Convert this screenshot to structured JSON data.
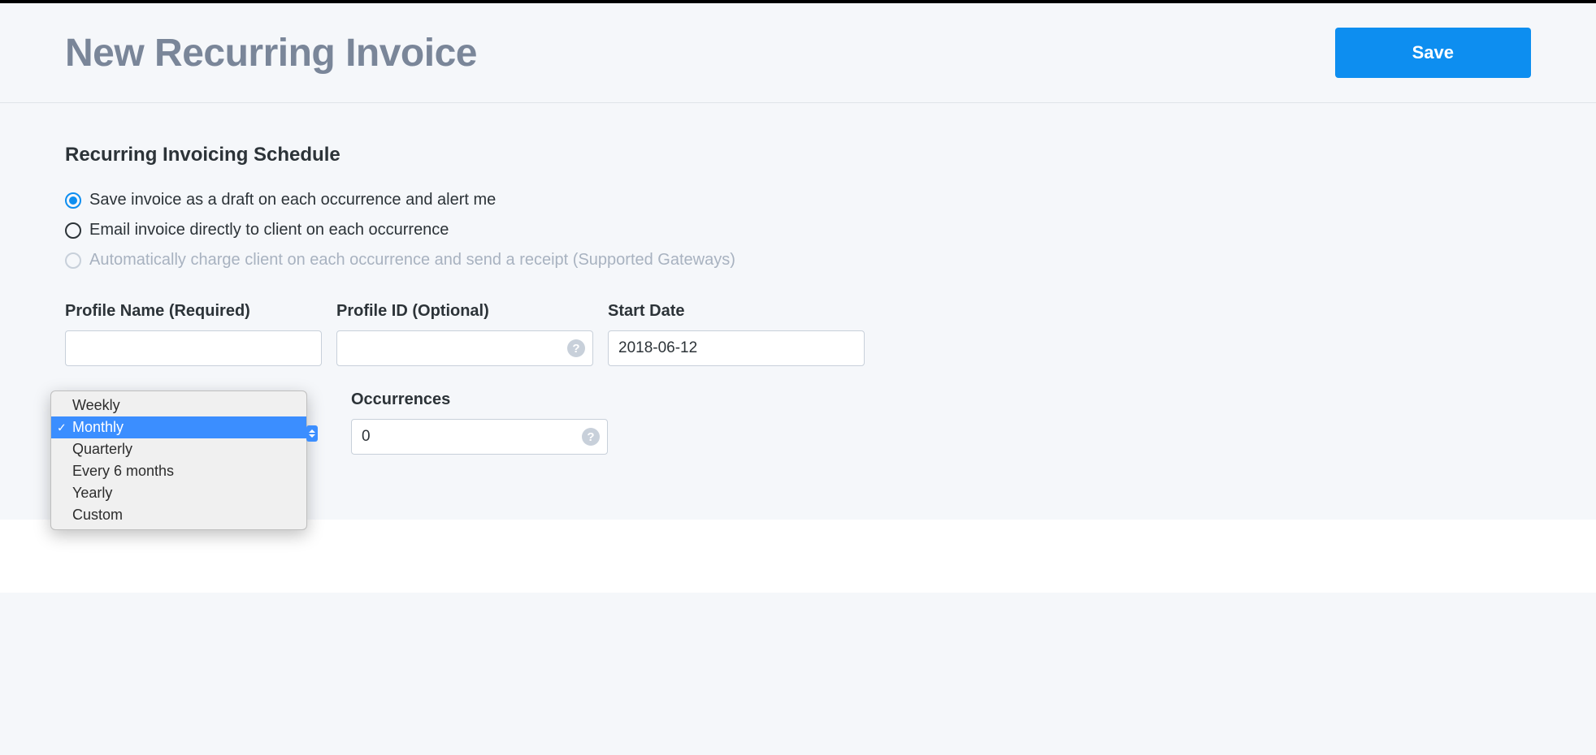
{
  "header": {
    "title": "New Recurring Invoice",
    "save_label": "Save"
  },
  "section": {
    "title": "Recurring Invoicing Schedule"
  },
  "radio_options": {
    "draft": "Save invoice as a draft on each occurrence and alert me",
    "email": "Email invoice directly to client on each occurrence",
    "auto_charge": "Automatically charge client on each occurrence and send a receipt (Supported Gateways)"
  },
  "fields": {
    "profile_name": {
      "label": "Profile Name (Required)",
      "value": ""
    },
    "profile_id": {
      "label": "Profile ID (Optional)",
      "value": ""
    },
    "start_date": {
      "label": "Start Date",
      "value": "2018-06-12"
    },
    "occurrences": {
      "label": "Occurrences",
      "value": "0"
    }
  },
  "frequency_dropdown": {
    "options": {
      "weekly": "Weekly",
      "monthly": "Monthly",
      "quarterly": "Quarterly",
      "every_6_months": "Every 6 months",
      "yearly": "Yearly",
      "custom": "Custom"
    },
    "selected": "Monthly"
  },
  "help_icon_text": "?"
}
